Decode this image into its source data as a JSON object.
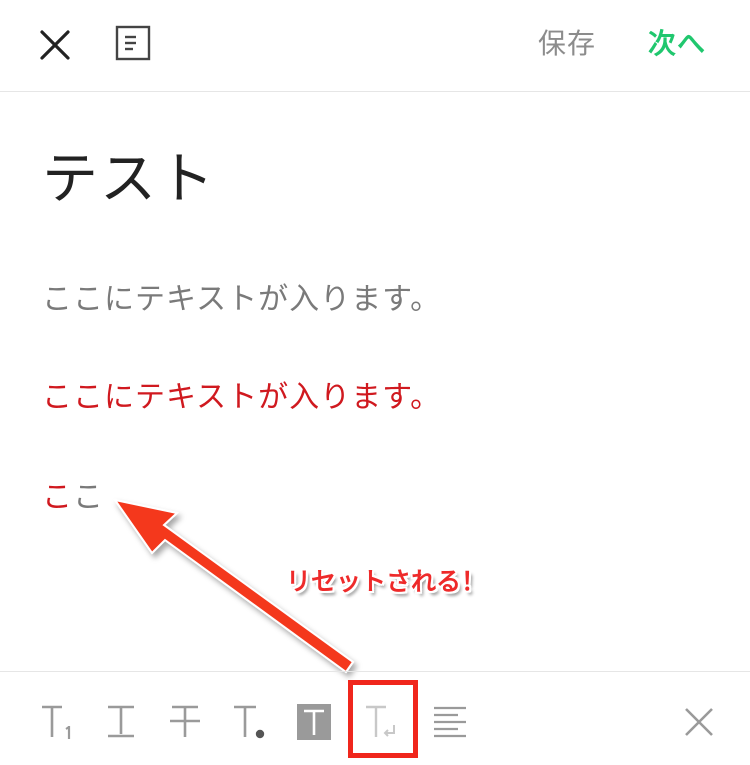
{
  "header": {
    "save_label": "保存",
    "next_label": "次へ"
  },
  "content": {
    "title": "テスト",
    "paragraph_1": "ここにテキストが入ります。",
    "paragraph_2": "ここにテキストが入ります。",
    "paragraph_3_red": "こ",
    "paragraph_3_gray": "こ"
  },
  "annotation": {
    "label": "リセットされる！"
  },
  "toolbar": {
    "tools": [
      {
        "icon": "text-size-small-icon"
      },
      {
        "icon": "text-size-medium-icon"
      },
      {
        "icon": "strikethrough-icon"
      },
      {
        "icon": "text-color-icon"
      },
      {
        "icon": "text-highlight-icon"
      },
      {
        "icon": "reset-format-icon"
      },
      {
        "icon": "align-left-icon"
      },
      {
        "icon": "close-icon"
      }
    ]
  },
  "colors": {
    "accent_green": "#20c76e",
    "text_red": "#d0191f",
    "annotation_red": "#f0261c",
    "muted_gray": "#8c8c8c"
  }
}
